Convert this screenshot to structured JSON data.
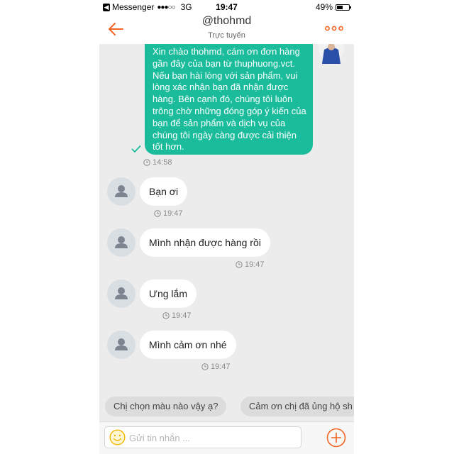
{
  "status_bar": {
    "back_app": "Messenger",
    "signal": "●●●○○",
    "network": "3G",
    "time": "19:47",
    "battery": "49%",
    "battery_level": 0.49
  },
  "header": {
    "title": "@thohmd",
    "subtitle": "Trực tuyến"
  },
  "messages": {
    "outgoing": {
      "text": "Xin chào thohmd, cám ơn đơn hàng gần đây của bạn từ thuphuong.vct. Nếu bạn hài lòng với sản phẩm, vui lòng xác nhận bạn đã nhận được hàng. Bên cạnh đó, chúng tôi luôn trông chờ những đóng góp ý kiến của bạn để sản phẩm và dịch vụ của chúng tôi ngày càng được cải thiện tốt hơn.",
      "time": "14:58"
    },
    "incoming": [
      {
        "text": "Bạn ơi",
        "time": "19:47"
      },
      {
        "text": "Mình nhận được hàng rồi",
        "time": "19:47"
      },
      {
        "text": "Ưng lắm",
        "time": "19:47"
      },
      {
        "text": "Mình cảm ơn nhé",
        "time": "19:47"
      }
    ]
  },
  "quick_replies": [
    "Chị chọn màu nào vậy ạ?",
    "Cảm ơn chị đã ủng hộ sh"
  ],
  "composer": {
    "placeholder": "Gửi tin nhắn ..."
  },
  "colors": {
    "accent": "#f26522",
    "bubble_out": "#1abc9c",
    "background": "#ececec"
  },
  "icons": {
    "back": "arrow-left-icon",
    "more": "more-dots-icon",
    "emoji": "smiley-icon",
    "add": "plus-circle-icon",
    "clock": "clock-icon",
    "check": "checkmark-icon",
    "avatar": "person-avatar-icon"
  }
}
